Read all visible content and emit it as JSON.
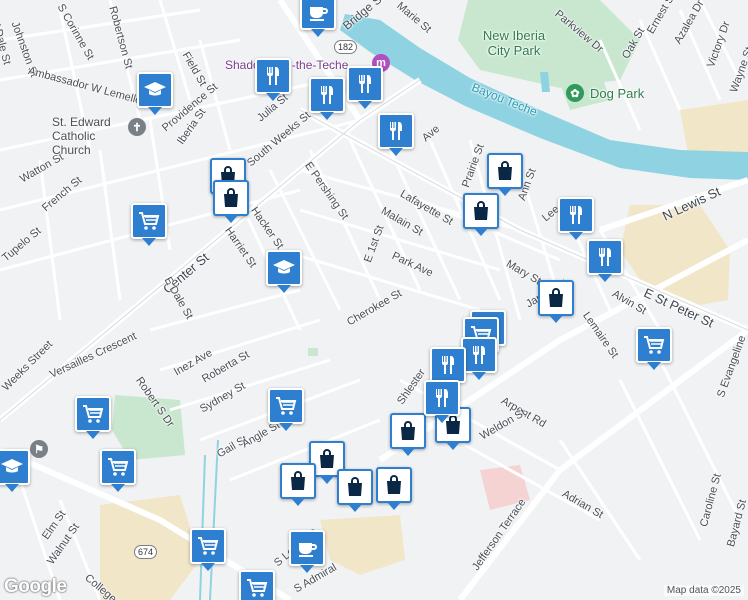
{
  "map": {
    "streets": [
      "Bridge St",
      "Parkview Dr",
      "Ernest St",
      "Azalea Dr",
      "Oak St",
      "Victory Dr",
      "Wayne St",
      "S Corinne St",
      "Robertson St",
      "Johnston St",
      "W Dale St",
      "Ambassador W Lemelle Dr",
      "Field St",
      "Providence St",
      "Julia St",
      "South Weeks St",
      "Iberia St",
      "Watton St",
      "French St",
      "Tupelo St",
      "Center St",
      "Hacker St",
      "Harriet St",
      "E Pershing St",
      "Lafayette St",
      "Malain St",
      "Prairie St",
      "Ann St",
      "Lee St",
      "E 1st St",
      "Park Ave",
      "N Lewis St",
      "E St Peter St",
      "Mary St",
      "Alvin St",
      "Lemaire St",
      "James St",
      "S Evangeline",
      "Cherokee St",
      "E Dale St",
      "Weeks Street",
      "Versailles Crescent",
      "Inez Ave",
      "Roberta St",
      "Robert S Dr",
      "Sydney St",
      "Gail St",
      "Angle St",
      "Shlester",
      "Arpent Rd",
      "Weldon St",
      "Adrian St",
      "Jefferson Terrace",
      "Caroline St",
      "Bayard St",
      "Elm St",
      "Walnut St",
      "College Rd",
      "S Lewis St",
      "S Admiral",
      "Center St",
      "Peter St",
      "Marie St",
      "Ave"
    ],
    "places": {
      "park_name": "New Iberia City Park",
      "dog_park": "Dog Park",
      "water": "Bayou Teche",
      "church": "St. Edward Catholic Church",
      "shadows": "Shadows-on-the-Teche",
      "route_182": "182",
      "route_674": "674"
    },
    "attribution": {
      "google": "Google",
      "map_data": "Map data ©2025"
    },
    "colors": {
      "background": "#f1f2f4",
      "park": "#c9e7cf",
      "water": "#8fd3e2",
      "industrial": "#f1e6c8",
      "pin": "#2f7fd0"
    }
  },
  "pins": [
    {
      "type": "cafe-icon"
    },
    {
      "type": "restaurant-icon"
    },
    {
      "type": "restaurant-icon"
    },
    {
      "type": "restaurant-icon"
    },
    {
      "type": "restaurant-icon"
    },
    {
      "type": "education-icon"
    },
    {
      "type": "shopping-bag-icon"
    },
    {
      "type": "shopping-bag-icon"
    },
    {
      "type": "shopping-cart-icon"
    },
    {
      "type": "education-icon"
    },
    {
      "type": "shopping-bag-icon"
    },
    {
      "type": "shopping-bag-icon"
    },
    {
      "type": "restaurant-icon"
    },
    {
      "type": "restaurant-icon"
    },
    {
      "type": "shopping-bag-icon"
    },
    {
      "type": "shopping-cart-icon"
    },
    {
      "type": "shopping-cart-icon"
    },
    {
      "type": "shopping-cart-icon"
    },
    {
      "type": "restaurant-icon"
    },
    {
      "type": "restaurant-icon"
    },
    {
      "type": "shopping-bag-icon"
    },
    {
      "type": "shopping-bag-icon"
    },
    {
      "type": "shopping-cart-icon"
    },
    {
      "type": "education-icon"
    },
    {
      "type": "shopping-cart-icon"
    },
    {
      "type": "shopping-bag-icon"
    },
    {
      "type": "shopping-bag-icon"
    },
    {
      "type": "shopping-bag-icon"
    },
    {
      "type": "shopping-bag-icon"
    },
    {
      "type": "shopping-cart-icon"
    },
    {
      "type": "cafe-icon"
    },
    {
      "type": "shopping-cart-icon"
    }
  ]
}
